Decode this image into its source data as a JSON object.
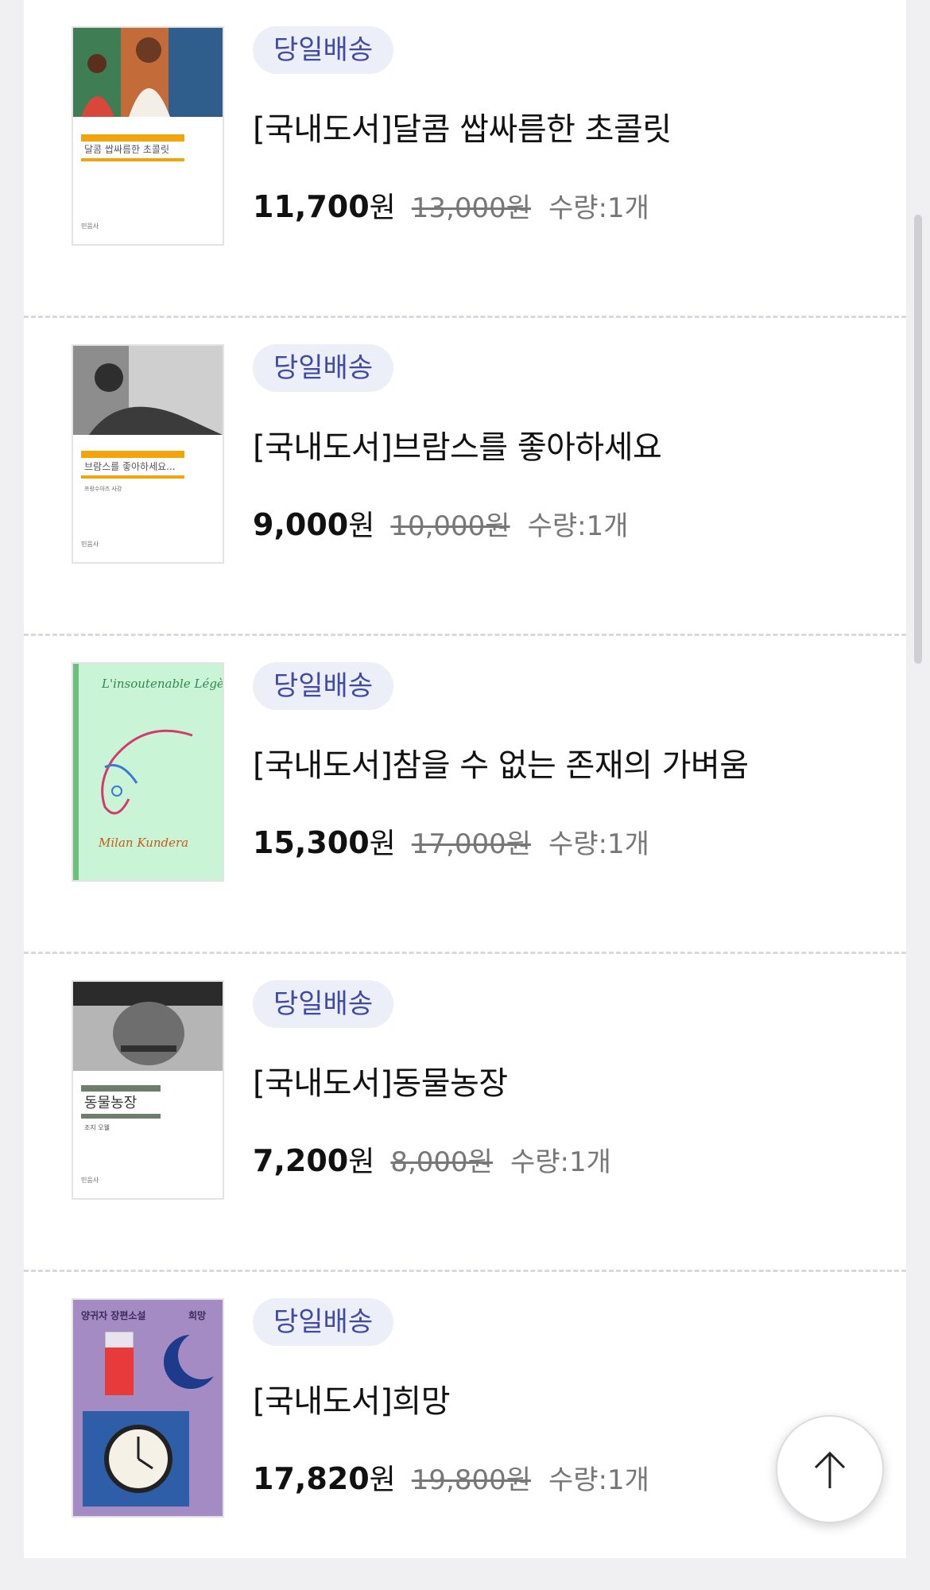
{
  "items": [
    {
      "badge": "당일배송",
      "title": "[국내도서]달콤 쌉싸름한 초콜릿",
      "price": "11,700",
      "currency": "원",
      "original_price": "13,000원",
      "quantity": "수량:1개",
      "cover_title": "달콤 쌉싸름한 초콜릿"
    },
    {
      "badge": "당일배송",
      "title": "[국내도서]브람스를 좋아하세요",
      "price": "9,000",
      "currency": "원",
      "original_price": "10,000원",
      "quantity": "수량:1개",
      "cover_title": "브람스를 좋아하세요..."
    },
    {
      "badge": "당일배송",
      "title": "[국내도서]참을 수 없는 존재의 가벼움",
      "price": "15,300",
      "currency": "원",
      "original_price": "17,000원",
      "quantity": "수량:1개",
      "cover_title": "L'insoutenable Légèreté de L'être"
    },
    {
      "badge": "당일배송",
      "title": "[국내도서]동물농장",
      "price": "7,200",
      "currency": "원",
      "original_price": "8,000원",
      "quantity": "수량:1개",
      "cover_title": "동물농장"
    },
    {
      "badge": "당일배송",
      "title": "[국내도서]희망",
      "price": "17,820",
      "currency": "원",
      "original_price": "19,800원",
      "quantity": "수량:1개",
      "cover_title": "희망"
    }
  ],
  "covers": {
    "brams_author": "프랑수아즈 사강",
    "animal_author": "조지 오웰",
    "kundera_author": "Milan Kundera",
    "hope_series": "양귀자 장편소설"
  },
  "colors": {
    "badge_bg": "#eceef8",
    "badge_text": "#3f4aa6",
    "divider": "#d9d9dd"
  }
}
